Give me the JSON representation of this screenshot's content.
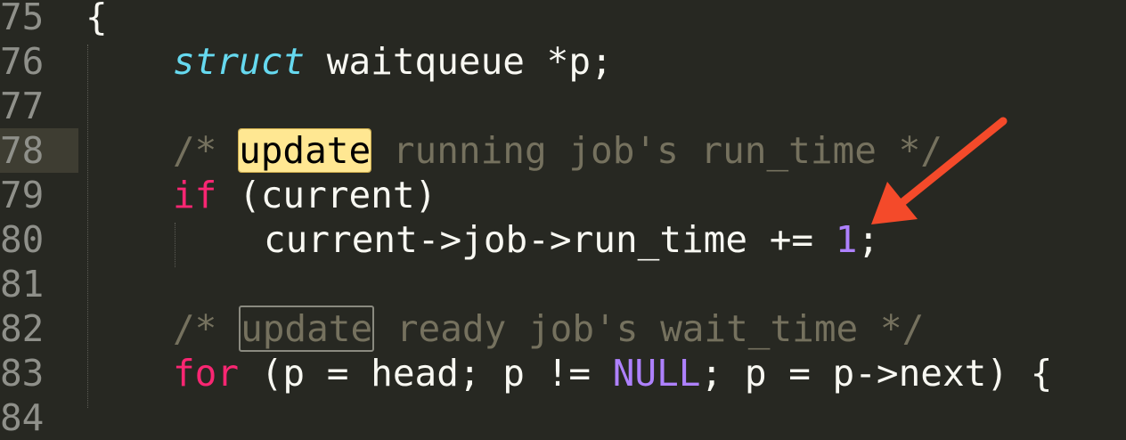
{
  "editor": {
    "lines": [
      {
        "num": "75",
        "code": "{"
      },
      {
        "num": "76",
        "kw": "struct",
        "rest": " waitqueue *p;"
      },
      {
        "num": "77",
        "code": ""
      },
      {
        "num": "78",
        "pre": "/* ",
        "hl": "update",
        "post": " running job's run_time */"
      },
      {
        "num": "79",
        "kw": "if",
        "rest": " (current)"
      },
      {
        "num": "80",
        "pre": "current->job->run_time += ",
        "numval": "1",
        "post": ";"
      },
      {
        "num": "81",
        "code": ""
      },
      {
        "num": "82",
        "pre": "/* ",
        "hl": "update",
        "post": " ready job's wait_time */"
      },
      {
        "num": "83",
        "kw": "for",
        "mid": " (p = head; p != ",
        "const": "NULL",
        "rest": "; p = p->next) {"
      },
      {
        "num": "84",
        "code": ""
      }
    ]
  },
  "colors": {
    "background": "#272822",
    "keyword": "#f92672",
    "type": "#66d9ef",
    "number": "#ae81ff",
    "comment": "#75715e",
    "find_highlight": "#ffe792",
    "arrow": "#f44a2a"
  }
}
